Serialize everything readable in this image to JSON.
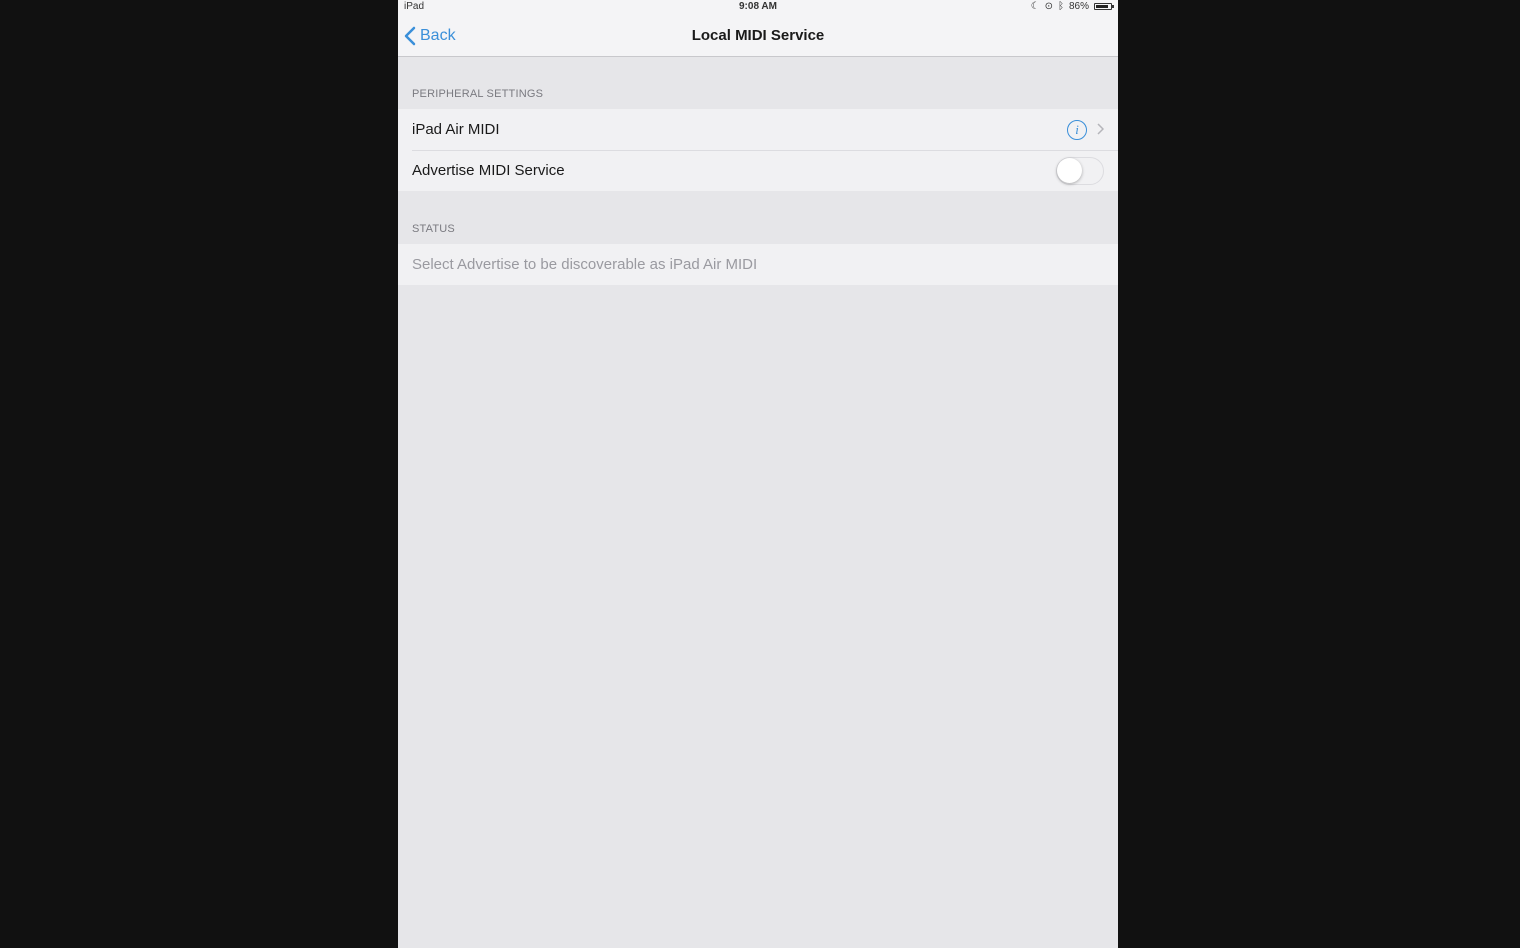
{
  "status_bar": {
    "device": "iPad",
    "time": "9:08 AM",
    "battery_percent": "86%",
    "battery_level": 0.86,
    "icons": [
      "moon-icon",
      "location-icon",
      "bluetooth-icon",
      "battery-icon"
    ]
  },
  "nav": {
    "back_label": "Back",
    "title": "Local MIDI Service"
  },
  "peripheral_section": {
    "header": "PERIPHERAL SETTINGS",
    "name_row": "iPad Air MIDI",
    "advertise_row": "Advertise MIDI Service",
    "advertise_on": false
  },
  "status_section": {
    "header": "STATUS",
    "message": "Select Advertise to be discoverable as iPad Air MIDI"
  },
  "colors": {
    "accent": "#3a8fd9",
    "background": "#e6e6e9",
    "cell": "#f1f1f3"
  }
}
